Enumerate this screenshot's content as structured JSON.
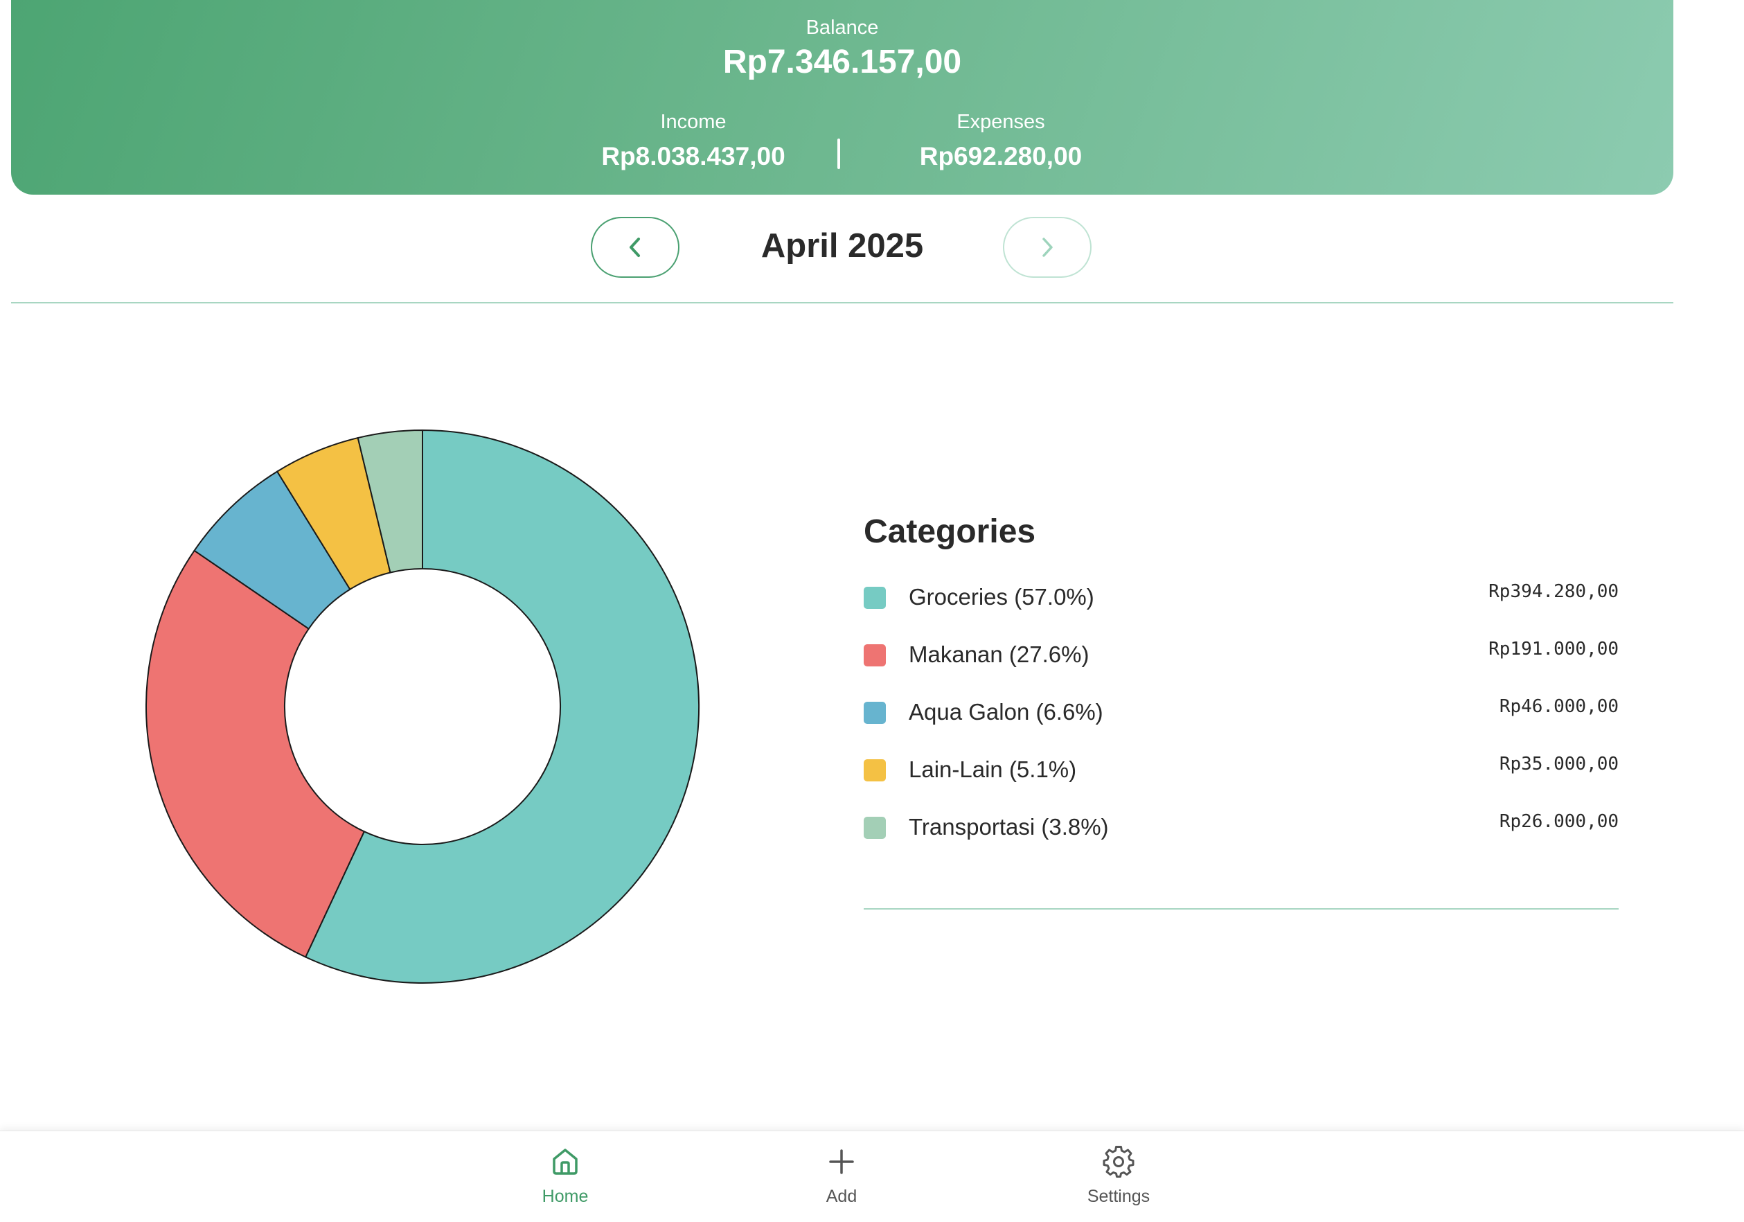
{
  "header": {
    "balance_label": "Balance",
    "balance_value": "Rp7.346.157,00",
    "income_label": "Income",
    "income_value": "Rp8.038.437,00",
    "expenses_label": "Expenses",
    "expenses_value": "Rp692.280,00"
  },
  "month_nav": {
    "month_label": "April 2025",
    "prev_icon": "chevron-left-icon",
    "next_icon": "chevron-right-icon"
  },
  "legend": {
    "title": "Categories",
    "items": [
      {
        "name": "Groceries (57.0%)",
        "amount": "Rp394.280,00",
        "color": "#76cbc3"
      },
      {
        "name": "Makanan (27.6%)",
        "amount": "Rp191.000,00",
        "color": "#ee7472"
      },
      {
        "name": "Aqua Galon (6.6%)",
        "amount": "Rp46.000,00",
        "color": "#67b4cf"
      },
      {
        "name": "Lain-Lain (5.1%)",
        "amount": "Rp35.000,00",
        "color": "#f4c144"
      },
      {
        "name": "Transportasi (3.8%)",
        "amount": "Rp26.000,00",
        "color": "#a3cfb6"
      }
    ]
  },
  "chart_data": {
    "type": "pie",
    "categories": [
      "Groceries",
      "Makanan",
      "Aqua Galon",
      "Lain-Lain",
      "Transportasi"
    ],
    "values": [
      394280,
      191000,
      46000,
      35000,
      26000
    ],
    "percentages": [
      57.0,
      27.6,
      6.6,
      5.1,
      3.8
    ],
    "colors": [
      "#76cbc3",
      "#ee7472",
      "#67b4cf",
      "#f4c144",
      "#a3cfb6"
    ],
    "donut": true
  },
  "bottom_nav": {
    "items": [
      {
        "label": "Home",
        "icon": "home-icon",
        "active": true
      },
      {
        "label": "Add",
        "icon": "plus-icon",
        "active": false
      },
      {
        "label": "Settings",
        "icon": "gear-icon",
        "active": false
      }
    ]
  }
}
